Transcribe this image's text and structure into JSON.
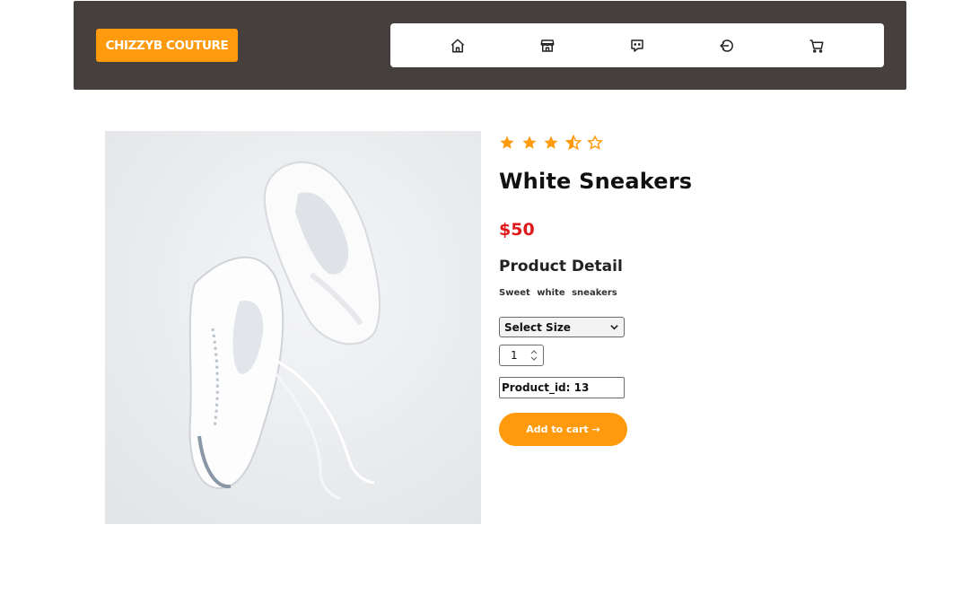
{
  "header": {
    "brand": "CHIZZYB COUTURE",
    "nav": [
      {
        "icon": "home-icon"
      },
      {
        "icon": "store-icon"
      },
      {
        "icon": "chat-icon"
      },
      {
        "icon": "logout-icon"
      },
      {
        "icon": "cart-icon"
      }
    ]
  },
  "product": {
    "image_alt": "white sneakers",
    "rating": 3.5,
    "rating_max": 5,
    "title": "White Sneakers",
    "price": "$50",
    "detail_heading": "Product Detail",
    "detail_text": "Sweet white sneakers",
    "size_select": "Select Size",
    "quantity": "1",
    "product_id": "Product_id: 13",
    "add_to_cart": "Add to cart →"
  },
  "colors": {
    "header_bg": "#453f3d",
    "accent": "#ff9a0c",
    "price": "#e01a1a",
    "star": "#ff9a0c"
  }
}
